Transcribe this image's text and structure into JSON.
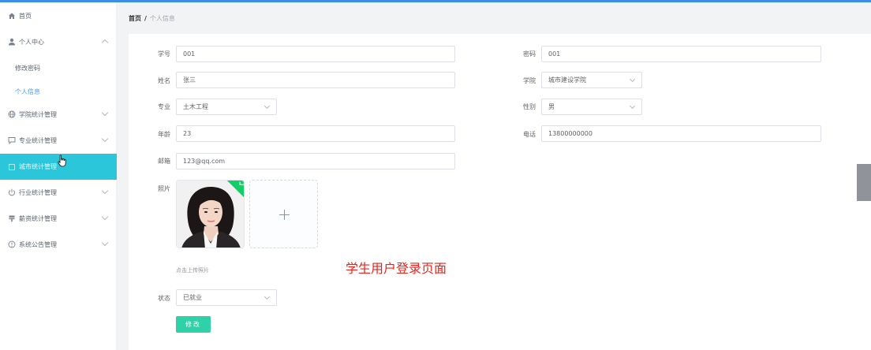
{
  "sidebar": {
    "items": [
      {
        "label": "首页",
        "icon": "home-icon"
      },
      {
        "label": "个人中心",
        "icon": "user-icon",
        "expanded": true
      },
      {
        "label": "学院统计管理",
        "icon": "globe-icon"
      },
      {
        "label": "专业统计管理",
        "icon": "chat-icon"
      },
      {
        "label": "城市统计管理",
        "icon": "building-icon",
        "active": true
      },
      {
        "label": "行业统计管理",
        "icon": "power-icon"
      },
      {
        "label": "薪资统计管理",
        "icon": "money-icon"
      },
      {
        "label": "系统公告管理",
        "icon": "notice-icon"
      }
    ],
    "sub_items": [
      {
        "label": "修改密码"
      },
      {
        "label": "个人信息",
        "active": true
      }
    ]
  },
  "breadcrumb": {
    "home": "首页",
    "separator": "/",
    "current": "个人信息"
  },
  "form": {
    "student_id": {
      "label": "学号",
      "value": "001"
    },
    "password": {
      "label": "密码",
      "value": "001"
    },
    "name": {
      "label": "姓名",
      "value": "张三"
    },
    "college": {
      "label": "学院",
      "value": "城市建设学院"
    },
    "major": {
      "label": "专业",
      "value": "土木工程"
    },
    "gender": {
      "label": "性别",
      "value": "男"
    },
    "age": {
      "label": "年龄",
      "value": "23"
    },
    "phone": {
      "label": "电话",
      "value": "13800000000"
    },
    "email": {
      "label": "邮箱",
      "value": "123@qq.com"
    },
    "photo": {
      "label": "照片",
      "tip": "点击上传照片"
    },
    "status": {
      "label": "状态",
      "value": "已就业"
    },
    "submit_label": "修改"
  },
  "overlay_caption": "学生用户登录页面",
  "colors": {
    "accent": "#2bc6d9",
    "primary": "#3b8fe6",
    "button": "#2fd1a7",
    "success": "#13ce66",
    "caption": "#e5251c"
  }
}
